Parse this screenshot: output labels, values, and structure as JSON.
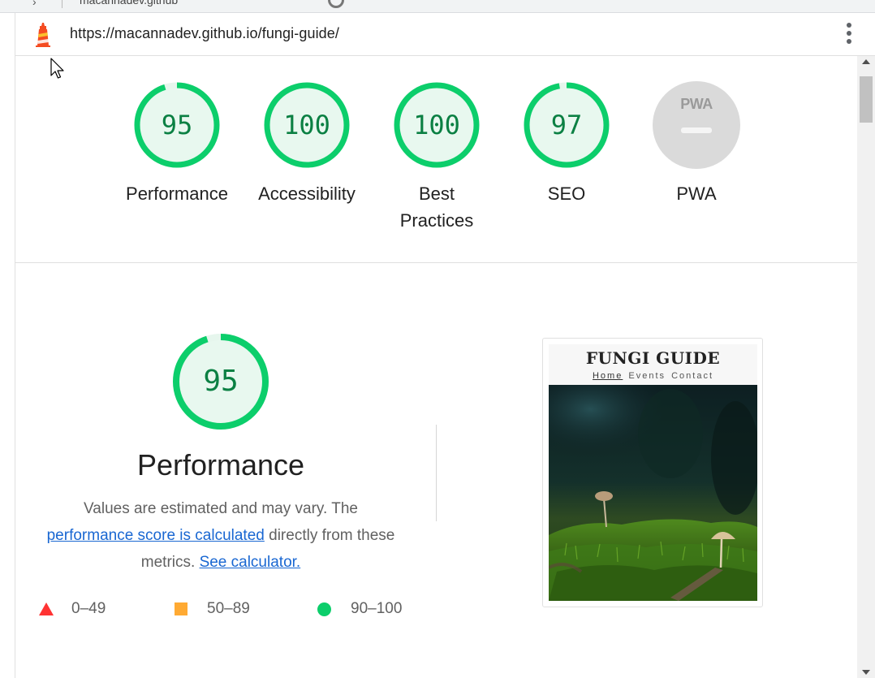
{
  "browser": {
    "tab_title": "macannadev.github",
    "url": "https://macannadev.github.io/fungi-guide/"
  },
  "categories": [
    {
      "name": "Performance",
      "score": 95
    },
    {
      "name": "Accessibility",
      "score": 100
    },
    {
      "name": "Best Practices",
      "score": 100
    },
    {
      "name": "SEO",
      "score": 97
    },
    {
      "name": "PWA",
      "score": null,
      "badge_text": "PWA"
    }
  ],
  "performance": {
    "score": "95",
    "title": "Performance",
    "desc_prefix": "Values are estimated and may vary. The",
    "desc_link": "performance score is calculated",
    "desc_middle": "directly from these metrics.",
    "desc_calc_link": "See calculator."
  },
  "legend": {
    "fail": "0–49",
    "average": "50–89",
    "pass": "90–100"
  },
  "screenshot": {
    "site_title": "FUNGI GUIDE",
    "nav": [
      "Home",
      "Events",
      "Contact"
    ]
  },
  "colors": {
    "pass": "#0cce6b",
    "pass_text": "#0b8043",
    "pass_fill": "#e8f8ef",
    "average": "#ffaa33",
    "fail": "#ff3333",
    "link": "#1967d2"
  },
  "icons": {
    "logo": "lighthouse-icon",
    "menu": "kebab-menu-icon",
    "cursor": "mouse-cursor-icon"
  }
}
